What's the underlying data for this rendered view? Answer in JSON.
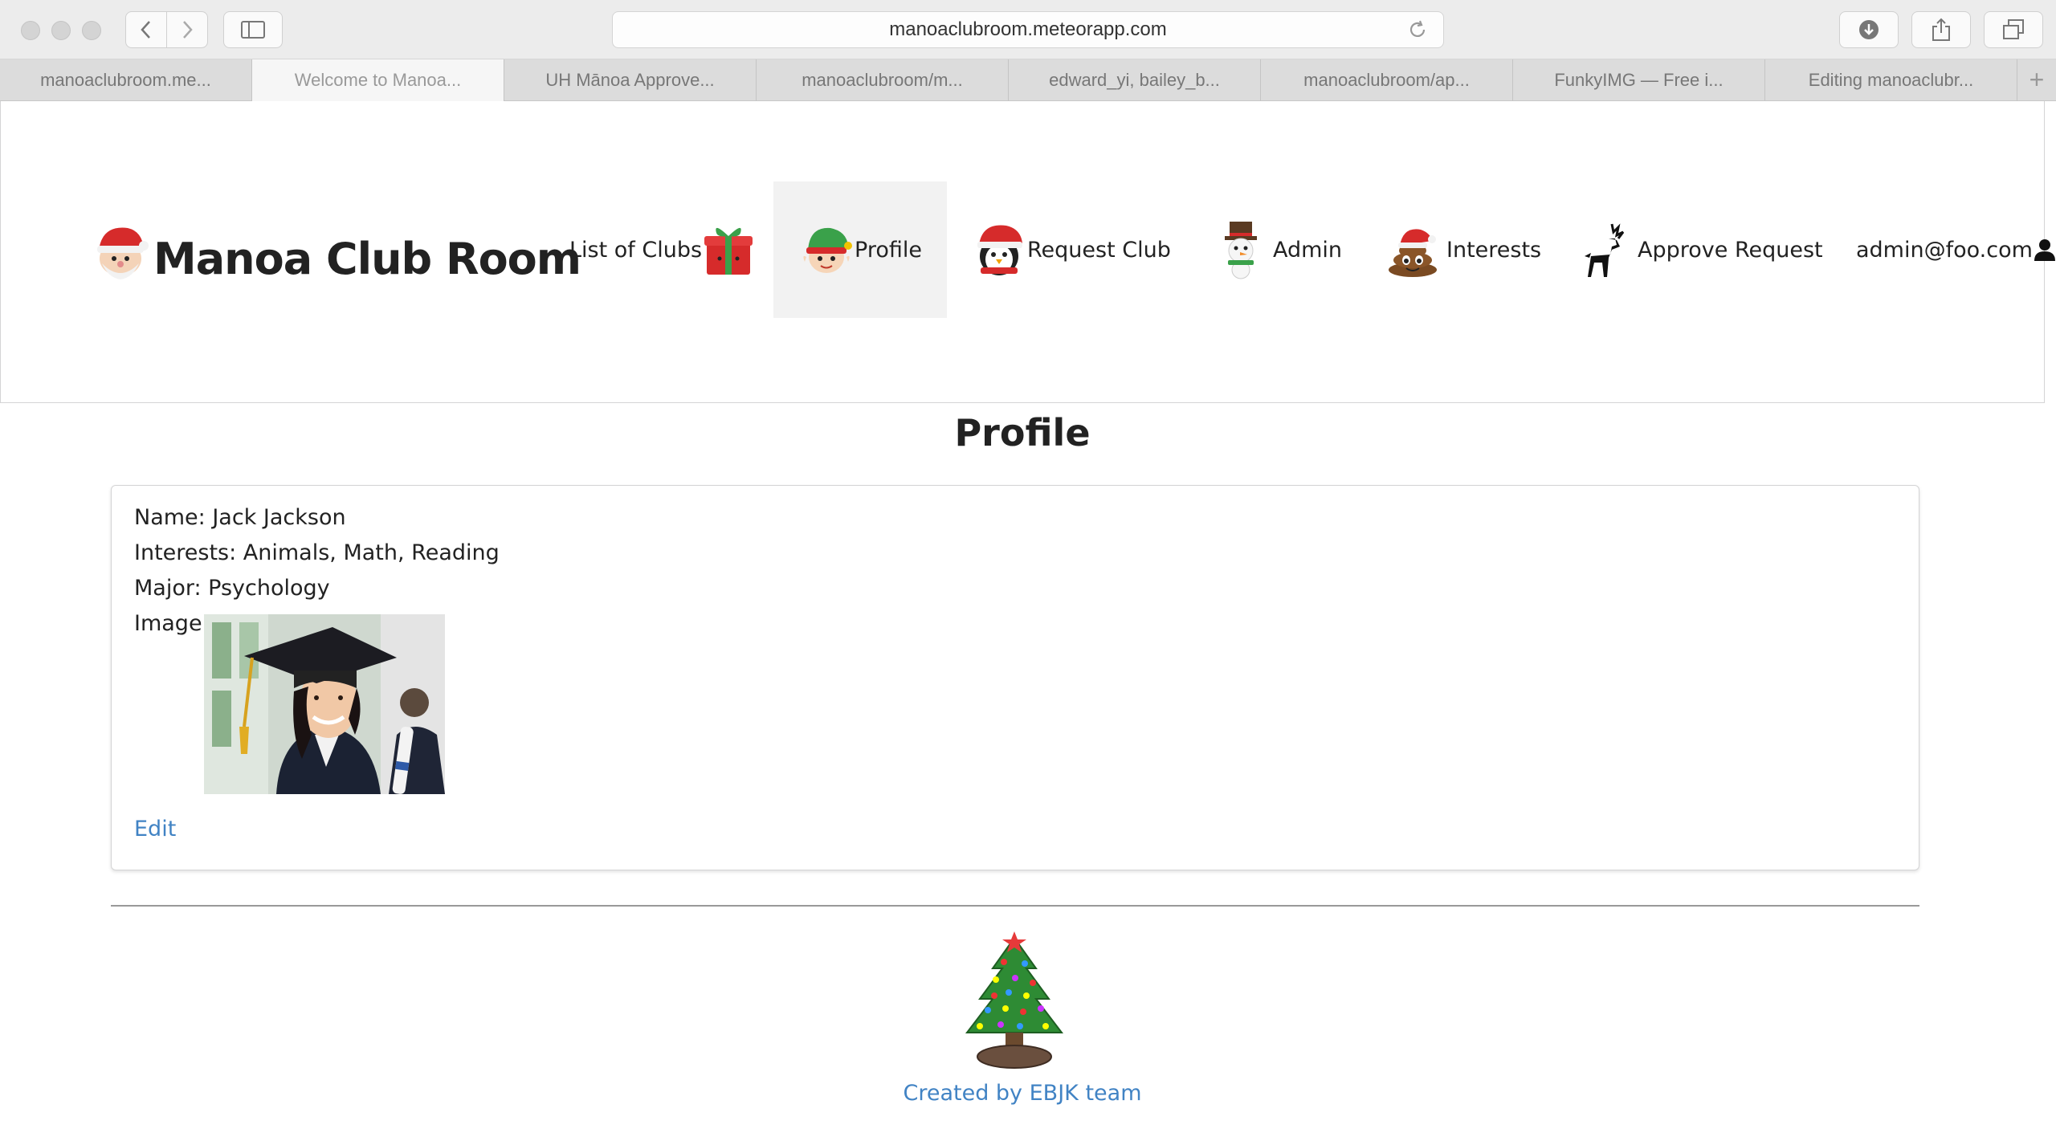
{
  "browser": {
    "url": "manoaclubroom.meteorapp.com",
    "tabs": [
      {
        "label": "manoaclubroom.me..."
      },
      {
        "label": "Welcome to Manoa..."
      },
      {
        "label": "UH Mānoa Approve..."
      },
      {
        "label": "manoaclubroom/m..."
      },
      {
        "label": "edward_yi, bailey_b..."
      },
      {
        "label": "manoaclubroom/ap..."
      },
      {
        "label": "FunkyIMG — Free i..."
      },
      {
        "label": "Editing manoaclubr..."
      }
    ],
    "new_tab": "+"
  },
  "nav": {
    "brand": "Manoa Club Room",
    "items": [
      {
        "label": "List of Clubs",
        "icon": "gift-icon"
      },
      {
        "label": "Profile",
        "icon": "elf-icon"
      },
      {
        "label": "Request Club",
        "icon": "penguin-icon"
      },
      {
        "label": "Admin",
        "icon": "snowman-icon"
      },
      {
        "label": "Interests",
        "icon": "santa-hat-poop-icon"
      },
      {
        "label": "Approve Request",
        "icon": "reindeer-icon"
      }
    ],
    "user": "admin@foo.com"
  },
  "profile": {
    "title": "Profile",
    "name": "Name: Jack Jackson",
    "interests": "Interests: Animals, Math, Reading",
    "major": "Major: Psychology",
    "image_label": "Image:",
    "edit": "Edit"
  },
  "footer": {
    "credit": "Created by EBJK team"
  },
  "colors": {
    "link": "#4183c4",
    "active_nav": "#f2f2f2"
  }
}
